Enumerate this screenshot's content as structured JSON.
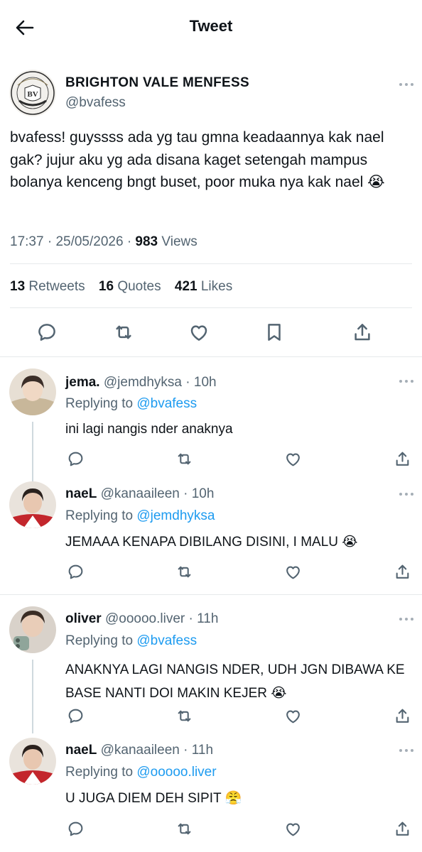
{
  "header": {
    "title": "Tweet",
    "back_icon": "arrow-left-icon"
  },
  "main_tweet": {
    "name": "BRIGHTON VALE MENFESS",
    "handle": "@bvafess",
    "avatar_text_top": "BRIGHTON VALE BASE",
    "avatar_monogram": "BV",
    "text": "bvafess! guyssss ada yg tau gmna keadaannya kak nael gak? jujur aku yg ada disana kaget setengah mampus bolanya kenceng bngt buset, poor muka nya kak nael 😭",
    "time": "17:37",
    "date": "25/05/2026",
    "views_count": "983",
    "views_label": "Views",
    "retweets_count": "13",
    "retweets_label": "Retweets",
    "quotes_count": "16",
    "quotes_label": "Quotes",
    "likes_count": "421",
    "likes_label": "Likes"
  },
  "replies": [
    {
      "name": "jema.",
      "handle": "@jemdhyksa",
      "time": "10h",
      "replying_label": "Replying to",
      "replying_to": "@bvafess",
      "text": "ini lagi nangis nder anaknya",
      "avatar_color": "#d8cfc4"
    },
    {
      "name": "naeL",
      "handle": "@kanaaileen",
      "time": "10h",
      "replying_label": "Replying to",
      "replying_to": "@jemdhyksa",
      "text": "JEMAAA KENAPA DIBILANG DISINI, I MALU 😭",
      "avatar_color": "#c9b8a8"
    },
    {
      "name": "oliver",
      "handle": "@ooooo.liver",
      "time": "11h",
      "replying_label": "Replying to",
      "replying_to": "@bvafess",
      "text": "ANAKNYA LAGI NANGIS NDER, UDH JGN DIBAWA KE BASE NANTI DOI MAKIN KEJER 😭",
      "avatar_color": "#b9aea3"
    },
    {
      "name": "naeL",
      "handle": "@kanaaileen",
      "time": "11h",
      "replying_label": "Replying to",
      "replying_to": "@ooooo.liver",
      "text": "U JUGA DIEM DEH SIPIT 😤",
      "avatar_color": "#c9b8a8"
    }
  ],
  "colors": {
    "link": "#1d9bf0",
    "muted": "#536471",
    "text": "#0f1419",
    "divider": "#e6e9eb"
  }
}
